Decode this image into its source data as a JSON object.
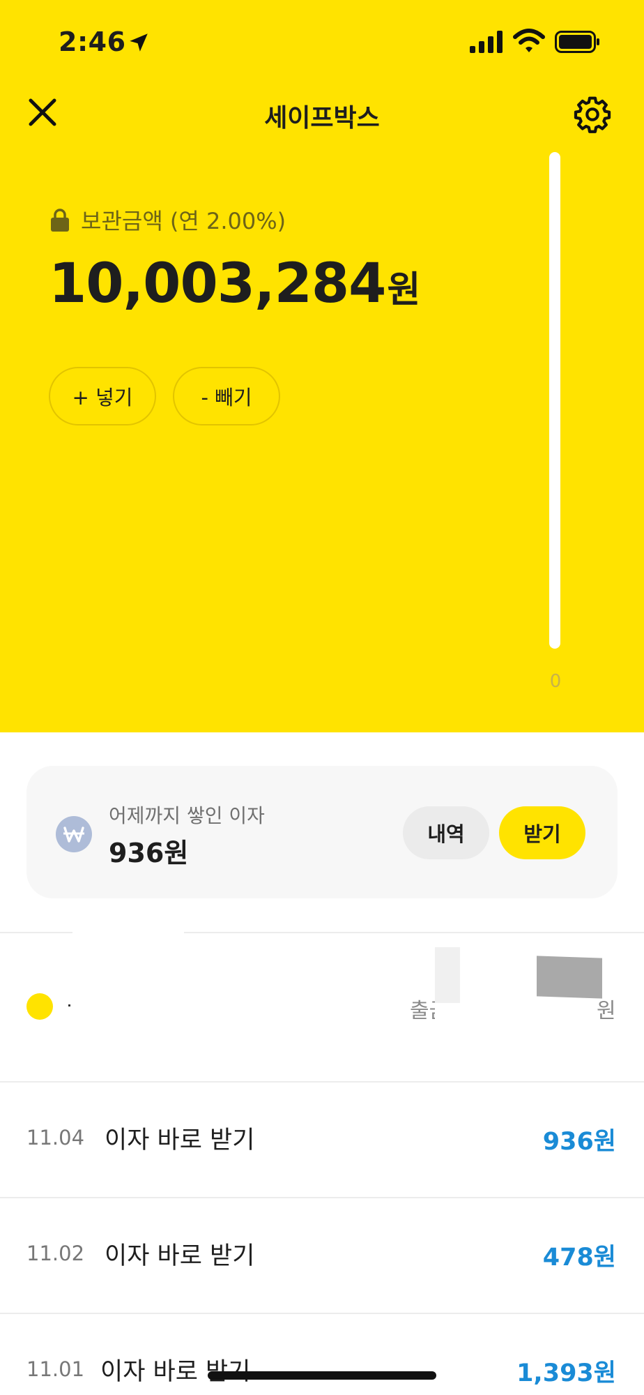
{
  "status_bar": {
    "time": "2:46"
  },
  "header": {
    "title": "세이프박스"
  },
  "balance": {
    "label": "보관금액 (연 2.00%)",
    "amount": "10,003,284",
    "unit": "원"
  },
  "actions": {
    "deposit_label": "+ 넣기",
    "withdraw_label": "- 빼기"
  },
  "scroll_gauge": {
    "label": "0"
  },
  "interest_card": {
    "label": "어제까지 쌓인 이자",
    "value": "936원",
    "history_label": "내역",
    "receive_label": "받기"
  },
  "legend": {
    "text": "출금",
    "unit": "원"
  },
  "transactions": [
    {
      "date": "11.04",
      "title": "이자 바로 받기",
      "amount": "936원"
    },
    {
      "date": "11.02",
      "title": "이자 바로 받기",
      "amount": "478원"
    },
    {
      "date": "11.01",
      "title": "이자 바로 받기",
      "amount": "1,393원"
    }
  ],
  "colors": {
    "brand_yellow": "#FFE300",
    "amount_blue": "#1A8BD6",
    "won_badge": "#AEBCD8"
  }
}
